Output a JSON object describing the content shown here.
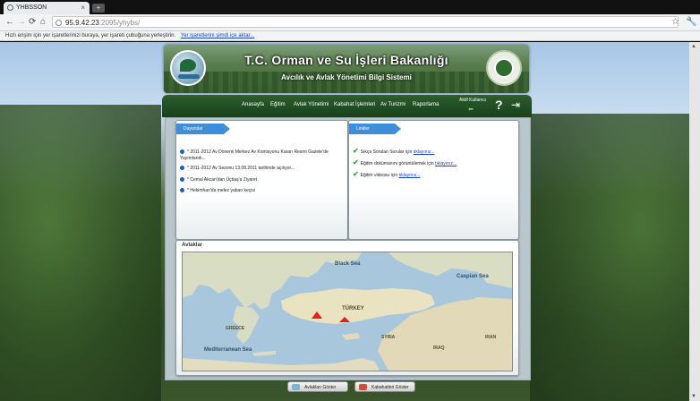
{
  "browser": {
    "tab_title": "YHBSSON",
    "tab_close": "×",
    "new_tab": "+",
    "url_host": "95.9.42.23",
    "url_rest": ":2095/yhybs/",
    "nav": {
      "back": "←",
      "forward": "→",
      "reload": "⟳",
      "home": "⌂"
    },
    "star": "☆",
    "wrench": "🔧"
  },
  "bookmarks_bar": {
    "text": "Hızlı erişim için yer işaretlerinizi buraya, yer işareti çubuğuna yerleştirin.",
    "link": "Yer işaretlerini şimdi içe aktar..."
  },
  "header": {
    "title": "T.C. Orman ve Su İşleri Bakanlığı",
    "subtitle": "Avcılık ve Avlak Yönetimi Bilgi Sistemi"
  },
  "nav": {
    "items": [
      "Anasayfa",
      "Eğitim",
      "Avlak Yönetimi",
      "Kabahat İşlemleri",
      "Av Turizmi",
      "Raporlama"
    ],
    "active_user": "Aktif Kullanıcı",
    "help": "?",
    "logout": "⇥"
  },
  "announcements": {
    "title": "Duyurular",
    "items": [
      "* 2011-2012 Av Dönemi Merkez Av Komisyonu Kararı Resmi Gazete'de Yayımlandı...",
      "* 2011-2012 Av Sezonu 13.08.2011 tarihinde açılıyor...",
      "* Cemal Akcan'dan Üçbaş'a Ziyaret",
      "* Hekimhan'da melez yaban keçisi"
    ]
  },
  "links": {
    "title": "Linkler",
    "items": [
      {
        "text": "Sıkça Sorulan Sorular için",
        "link": "tıklayınız..."
      },
      {
        "text": "Eğitim dokümanını görüntülemek için",
        "link": "tıklayınız..."
      },
      {
        "text": "Eğitim videosu için",
        "link": "tıklayınız..."
      }
    ]
  },
  "map": {
    "title": "Avlaklar",
    "labels": {
      "black_sea": "Black Sea",
      "caspian_sea": "Caspian Sea",
      "mediterranean": "Mediterranean Sea",
      "turkey": "TÜRKEY",
      "greece": "GREECE",
      "syria": "SYRIA",
      "iraq": "IRAQ",
      "iran": "IRAN"
    }
  },
  "buttons": {
    "show_avlaklar": "Avlakları Göster",
    "show_kabahatler": "Kabahatleri Göster"
  },
  "colors": {
    "nav_bg": "#18401c",
    "tab_blue": "#3e8fd9",
    "link": "#1a44b8",
    "check": "#37a53a",
    "marker": "#e12020"
  },
  "scrollbar": {
    "up": "▲",
    "down": "▼"
  }
}
